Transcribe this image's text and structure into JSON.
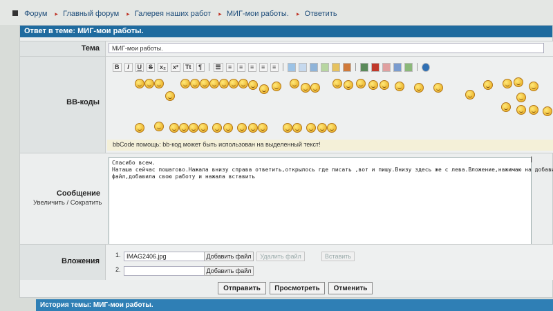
{
  "breadcrumb": {
    "items": [
      "Форум",
      "Главный форум",
      "Галерея наших работ",
      "МИГ-мои работы.",
      "Ответить"
    ]
  },
  "panel": {
    "title": "Ответ в теме: МИГ-мои работы."
  },
  "form": {
    "subject_label": "Тема",
    "subject_value": "МИГ-мои работы.",
    "bbcode_label": "BB-коды",
    "bbcode_help": "bbCode помощь: bb-код может быть использован на выделенный текст!",
    "message_label": "Сообщение",
    "zoom_in": "Увеличить",
    "zoom_out": "Сократить",
    "zoom_sep": "/",
    "message_lines": [
      "Спасибо всем.",
      "Наташа сейчас пошагово.Нажала внизу справа ответить,открылось где писать ,вот и пишу.Внизу здесь же с лева.Вложение,нажимаю на добавить",
      "файл,добавила свою работу и нажала вставить"
    ],
    "attachments_label": "Вложения",
    "attachment_1_num": "1.",
    "attachment_1_file": "IMAG2406.jpg",
    "attachment_2_num": "2.",
    "attachment_2_file": "",
    "add_file_label": "Добавить файл",
    "delete_file_label": "Удалить файл",
    "insert_label": "Вставить"
  },
  "toolbar": {
    "bold": "B",
    "italic": "I",
    "underline": "U",
    "strike": "S",
    "sub": "x₂",
    "sup": "x²",
    "tt": "Tt"
  },
  "actions": {
    "submit": "Отправить",
    "preview": "Просмотреть",
    "cancel": "Отменить"
  },
  "history": {
    "title": "История темы: МИГ-мои работы."
  }
}
